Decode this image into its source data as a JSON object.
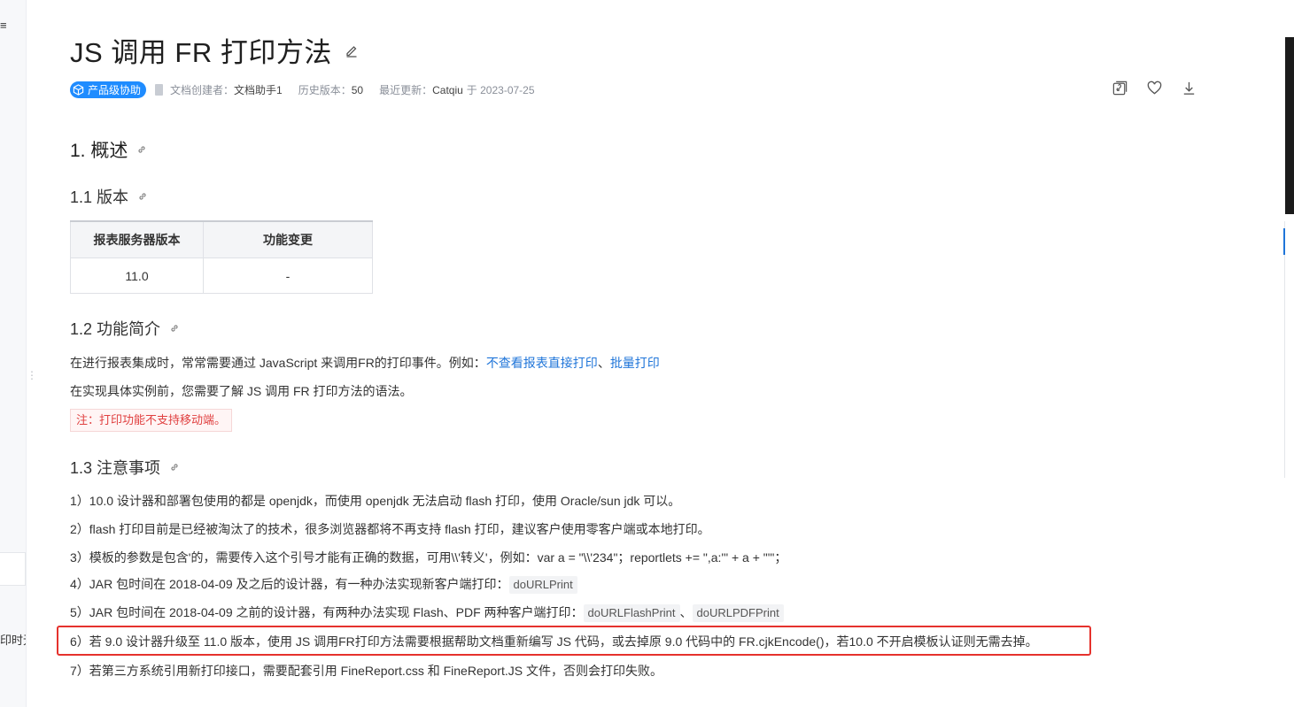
{
  "left_sidebar": {
    "menu_icon": "menu-icon",
    "truncated_text": "印时无"
  },
  "page": {
    "title": "JS 调用 FR 打印方法"
  },
  "meta": {
    "badge": "产品级协助",
    "creator_label": "文档创建者：",
    "creator": "文档助手1",
    "history_label": "历史版本：",
    "history_count": "50",
    "updated_label": "最近更新：",
    "updated_by": "Catqiu",
    "updated_on": "于 2023-07-25"
  },
  "actions": [
    {
      "icon": "copy-link-icon"
    },
    {
      "icon": "heart-icon"
    },
    {
      "icon": "download-icon"
    }
  ],
  "section1": {
    "heading": "1. 概述"
  },
  "section1_1": {
    "heading": "1.1 版本",
    "table": {
      "headers": [
        "报表服务器版本",
        "功能变更"
      ],
      "rows": [
        [
          "11.0",
          "-"
        ]
      ]
    }
  },
  "section1_2": {
    "heading": "1.2 功能简介",
    "p1_text": "在进行报表集成时，常常需要通过 JavaScript 来调用FR的打印事件。例如：",
    "p1_link1": "不查看报表直接打印",
    "p1_sep": "、",
    "p1_link2": "批量打印",
    "p2_text": "在实现具体实例前，您需要了解 JS 调用 FR 打印方法的语法。",
    "note": "注：打印功能不支持移动端。"
  },
  "section1_3": {
    "heading": "1.3 注意事项",
    "item1": "1）10.0 设计器和部署包使用的都是 openjdk，而使用 openjdk 无法启动 flash 打印，使用 Oracle/sun jdk 可以。",
    "item2": "2）flash 打印目前是已经被淘汰了的技术，很多浏览器都将不再支持 flash 打印，建议客户使用零客户端或本地打印。",
    "item3": "3）模板的参数是包含'的，需要传入这个引号才能有正确的数据，可用\\\\'转义'，例如：var a = \"\\\\'234\"；reportlets += \",a:'\" + a + \"'\"；",
    "item4_text": "4）JAR 包时间在 2018-04-09 及之后的设计器，有一种办法实现新客户端打印：",
    "item4_code": "doURLPrint",
    "item5_text": "5）JAR 包时间在 2018-04-09 之前的设计器，有两种办法实现 Flash、PDF 两种客户端打印：",
    "item5_code1": "doURLFlashPrint",
    "item5_sep": "、",
    "item5_code2": "doURLPDFPrint",
    "item6": "6）若 9.0 设计器升级至 11.0 版本，使用 JS 调用FR打印方法需要根据帮助文档重新编写 JS 代码，或去掉原 9.0 代码中的 FR.cjkEncode()，若10.0 不开启模板认证则无需去掉。",
    "item7": "7）若第三方系统引用新打印接口，需要配套引用 FineReport.css 和 FineReport.JS 文件，否则会打印失败。"
  },
  "colors": {
    "accent": "#1f75d9",
    "badge": "#1f8cff",
    "note_text": "#e04040",
    "highlight": "#e5322d"
  }
}
